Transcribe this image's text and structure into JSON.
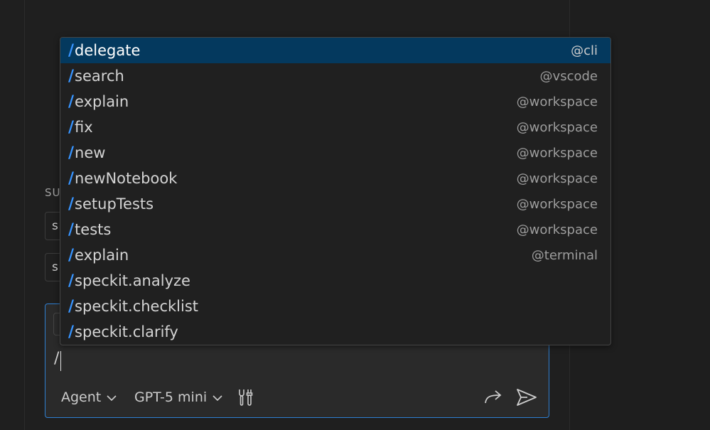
{
  "sidebar_partial": {
    "section_label": "SU",
    "box1_char": "s",
    "box2_char": "s"
  },
  "suggestions": [
    {
      "slash": "/",
      "command": "delegate",
      "agent": "@cli",
      "selected": true
    },
    {
      "slash": "/",
      "command": "search",
      "agent": "@vscode"
    },
    {
      "slash": "/",
      "command": "explain",
      "agent": "@workspace"
    },
    {
      "slash": "/",
      "command": "fix",
      "agent": "@workspace"
    },
    {
      "slash": "/",
      "command": "new",
      "agent": "@workspace"
    },
    {
      "slash": "/",
      "command": "newNotebook",
      "agent": "@workspace"
    },
    {
      "slash": "/",
      "command": "setupTests",
      "agent": "@workspace"
    },
    {
      "slash": "/",
      "command": "tests",
      "agent": "@workspace"
    },
    {
      "slash": "/",
      "command": "explain",
      "agent": "@terminal"
    },
    {
      "slash": "/",
      "command": "speckit.analyze",
      "agent": ""
    },
    {
      "slash": "/",
      "command": "speckit.checklist",
      "agent": ""
    },
    {
      "slash": "/",
      "command": "speckit.clarify",
      "agent": ""
    }
  ],
  "chat_input": {
    "value": "/",
    "mode_label": "Agent",
    "model_label": "GPT-5 mini"
  },
  "icons": {
    "mode_chevron": "chevron-down-icon",
    "model_chevron": "chevron-down-icon",
    "tools": "tools-icon",
    "delegate": "share-arrow-icon",
    "send": "send-icon"
  },
  "colors": {
    "accent": "#3794ff",
    "selected_row": "#04395e",
    "focus_border": "#2f7fd1"
  }
}
